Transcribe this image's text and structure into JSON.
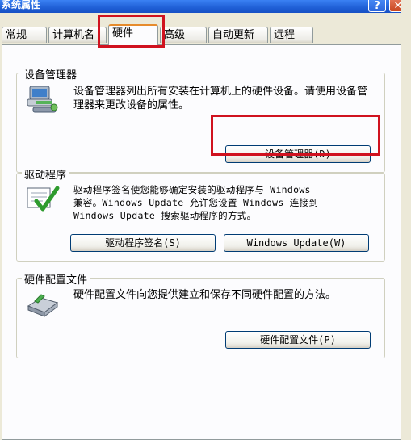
{
  "window": {
    "title": "系统属性",
    "help_glyph": "?",
    "close_glyph": "✕"
  },
  "tabs": [
    {
      "label": "常规"
    },
    {
      "label": "计算机名"
    },
    {
      "label": "硬件",
      "selected": true
    },
    {
      "label": "高级"
    },
    {
      "label": "自动更新"
    },
    {
      "label": "远程"
    }
  ],
  "device_manager": {
    "group_title": "设备管理器",
    "description": "设备管理器列出所有安装在计算机上的硬件设备。请使用设备管理器来更改设备的属性。",
    "icon": "device-manager-icon",
    "button_label": "设备管理器(D)"
  },
  "drivers": {
    "group_title": "驱动程序",
    "description_lines": [
      "驱动程序签名使您能够确定安装的驱动程序与 Windows",
      "兼容。Windows Update 允许您设置 Windows 连接到",
      "Windows Update 搜索驱动程序的方式。"
    ],
    "icon": "driver-signing-icon",
    "signing_button_label": "驱动程序签名(S)",
    "update_button_label": "Windows Update(W)"
  },
  "hardware_profiles": {
    "group_title": "硬件配置文件",
    "description": "硬件配置文件向您提供建立和保存不同硬件配置的方法。",
    "icon": "hardware-profile-icon",
    "button_label": "硬件配置文件(P)"
  },
  "colors": {
    "highlight": "#d0121f",
    "titlebar": "#1f5fd6",
    "selected_tab_accent": "#e68b2c"
  }
}
